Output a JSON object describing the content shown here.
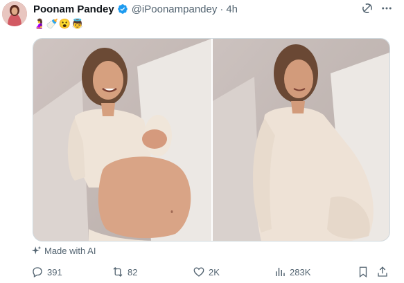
{
  "author": {
    "name": "Poonam Pandey",
    "handle": "@iPoonampandey",
    "separator": "·",
    "time": "4h"
  },
  "emojis": [
    "🤰",
    "🍼",
    "😮",
    "👼"
  ],
  "ai_label": "Made with AI",
  "actions": {
    "replies": "391",
    "reposts": "82",
    "likes": "2K",
    "views": "283K"
  },
  "colors": {
    "verified": "#1d9bf0",
    "text": "#0f1419",
    "muted": "#536471",
    "border": "#cfd9de"
  },
  "icons": [
    "verified-badge-icon",
    "grok-icon",
    "more-icon",
    "sparkle-icon",
    "reply-icon",
    "repost-icon",
    "like-icon",
    "views-icon",
    "bookmark-icon",
    "share-icon"
  ]
}
